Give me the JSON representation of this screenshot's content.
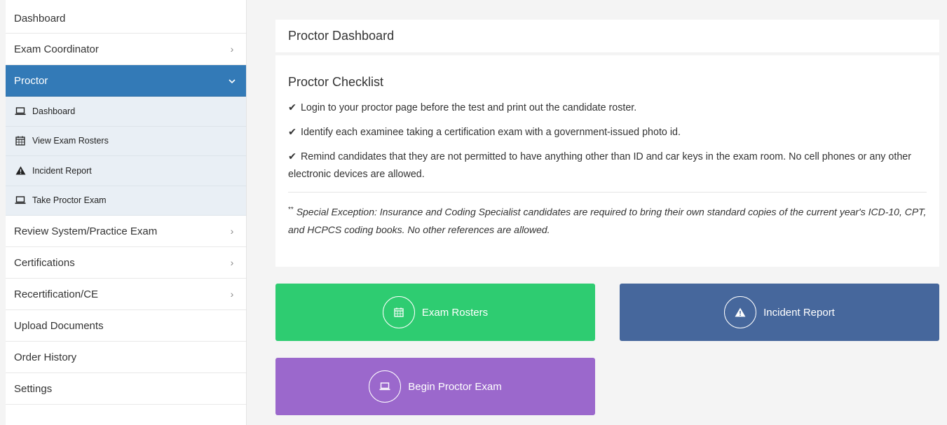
{
  "sidebar": {
    "items": [
      {
        "label": "Dashboard"
      },
      {
        "label": "Exam Coordinator"
      },
      {
        "label": "Proctor"
      }
    ],
    "sub_items": [
      {
        "label": "Dashboard",
        "icon": "laptop-icon"
      },
      {
        "label": "View Exam Rosters",
        "icon": "calendar-icon"
      },
      {
        "label": "Incident Report",
        "icon": "warning-icon"
      },
      {
        "label": "Take Proctor Exam",
        "icon": "laptop-icon"
      }
    ],
    "items_after": [
      {
        "label": "Review System/Practice Exam"
      },
      {
        "label": "Certifications"
      },
      {
        "label": "Recertification/CE"
      },
      {
        "label": "Upload Documents"
      },
      {
        "label": "Order History"
      },
      {
        "label": "Settings"
      }
    ]
  },
  "main": {
    "page_title": "Proctor Dashboard",
    "checklist_title": "Proctor Checklist",
    "checklist": [
      "Login to your proctor page before the test and print out the candidate roster.",
      "Identify each examinee taking a certification exam with a government-issued photo id.",
      "Remind candidates that they are not permitted to have anything other than ID and car keys in the exam room. No cell phones or any other electronic devices are allowed."
    ],
    "note_marker": "**",
    "note": "Special Exception: Insurance and Coding Specialist candidates are required to bring their own standard copies of the current year's ICD-10, CPT, and HCPCS coding books. No other references are allowed."
  },
  "actions": {
    "exam_rosters": "Exam Rosters",
    "incident_report": "Incident Report",
    "begin_proctor_exam": "Begin Proctor Exam"
  },
  "colors": {
    "active_nav": "#337ab7",
    "green": "#2ecc71",
    "blue": "#46679c",
    "purple": "#9b68cc"
  }
}
